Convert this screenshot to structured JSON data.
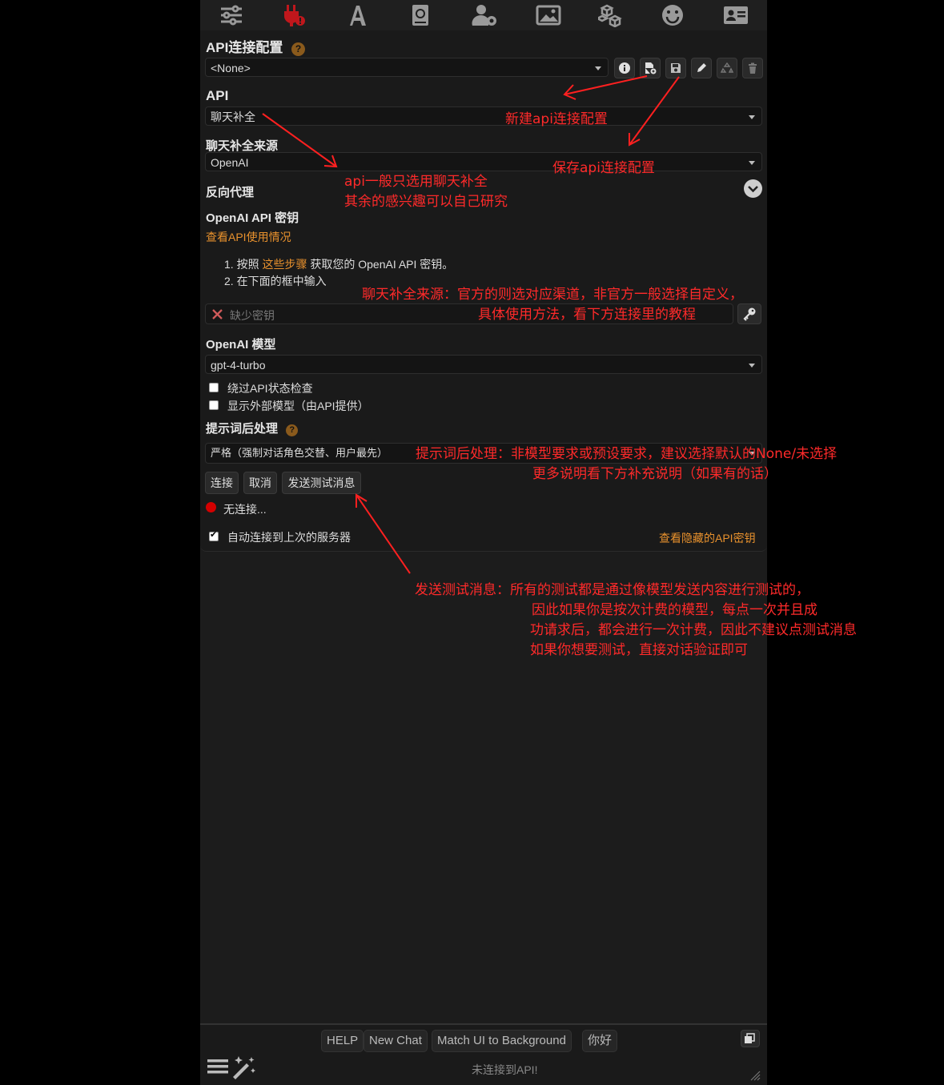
{
  "toolbar_icons": [
    "sliders-icon",
    "plug-icon",
    "font-icon",
    "book-icon",
    "user-gear-icon",
    "image-icon",
    "cubes-icon",
    "smile-icon",
    "id-card-icon"
  ],
  "api_config": {
    "title": "API连接配置",
    "help": "?",
    "selected_profile": "<None>"
  },
  "api": {
    "label": "API",
    "selected": "聊天补全"
  },
  "chat_source": {
    "label": "聊天补全来源",
    "selected": "OpenAI"
  },
  "reverse_proxy": {
    "label": "反向代理"
  },
  "openai_key": {
    "label": "OpenAI API 密钥",
    "usage_link": "查看API使用情况",
    "step1_prefix": "1. 按照 ",
    "step1_link": "这些步骤",
    "step1_suffix": " 获取您的 OpenAI API 密钥。",
    "step2": "2. 在下面的框中输入",
    "placeholder": "缺少密钥"
  },
  "model": {
    "label": "OpenAI 模型",
    "selected": "gpt-4-turbo"
  },
  "checkboxes": {
    "bypass_status": "绕过API状态检查",
    "show_external": "显示外部模型（由API提供）"
  },
  "postprocess": {
    "label": "提示词后处理",
    "help": "?",
    "selected": "严格（强制对话角色交替、用户最先）"
  },
  "buttons": {
    "connect": "连接",
    "cancel": "取消",
    "test": "发送测试消息"
  },
  "status": {
    "text": "无连接...",
    "color": "#d40000"
  },
  "auto_connect": {
    "label": "自动连接到上次的服务器",
    "checked": true,
    "hidden_keys_link": "查看隐藏的API密钥"
  },
  "quick_replies": [
    "HELP",
    "New Chat",
    "Match UI to Background",
    "你好"
  ],
  "bottom_status": "未连接到API!",
  "annotations": {
    "new_config": "新建api连接配置",
    "save_config": "保存api连接配置",
    "api_choice_1": "api一般只选用聊天补全",
    "api_choice_2": "其余的感兴趣可以自己研究",
    "source_1": "聊天补全来源：官方的则选对应渠道，非官方一般选择自定义，",
    "source_2": "具体使用方法，看下方连接里的教程",
    "postproc_1": "提示词后处理：非模型要求或预设要求，建议选择默认的None/未选择",
    "postproc_2": "更多说明看下方补充说明（如果有的话）",
    "test_1": "发送测试消息：所有的测试都是通过像模型发送内容进行测试的，",
    "test_2": "因此如果你是按次计费的模型，每点一次并且成",
    "test_3": "功请求后，都会进行一次计费，因此不建议点测试消息",
    "test_4": "如果你想要测试，直接对话验证即可"
  },
  "colors": {
    "accent_link": "#e8912d",
    "annotation": "#ff2a2a",
    "active_tab": "#c0171c"
  }
}
